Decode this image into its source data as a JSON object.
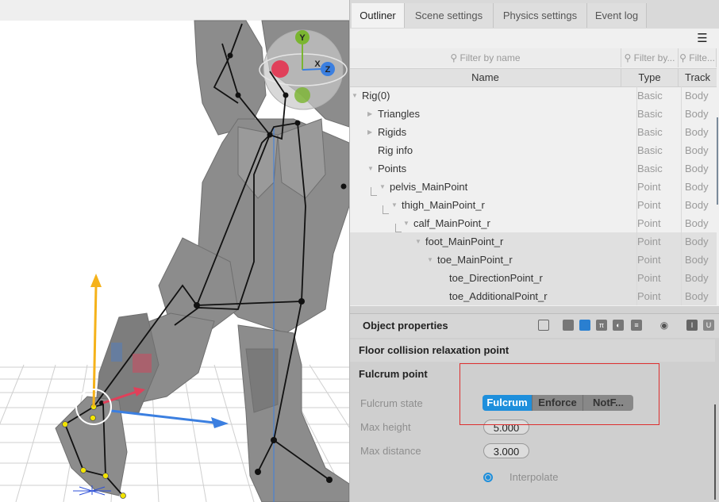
{
  "tabs": [
    "Outliner",
    "Scene settings",
    "Physics settings",
    "Event log"
  ],
  "outliner": {
    "menu_icon": "hamburger-menu-icon",
    "filters": {
      "name": "Filter by name",
      "type": "Filter by...",
      "track": "Filte..."
    },
    "columns": {
      "name": "Name",
      "type": "Type",
      "track": "Track"
    },
    "rows": [
      {
        "name": "Rig(0)",
        "type": "Basic",
        "track": "Body"
      },
      {
        "name": "Triangles",
        "type": "Basic",
        "track": "Body"
      },
      {
        "name": "Rigids",
        "type": "Basic",
        "track": "Body"
      },
      {
        "name": "Rig info",
        "type": "Basic",
        "track": "Body"
      },
      {
        "name": "Points",
        "type": "Basic",
        "track": "Body"
      },
      {
        "name": "pelvis_MainPoint",
        "type": "Point",
        "track": "Body"
      },
      {
        "name": "thigh_MainPoint_r",
        "type": "Point",
        "track": "Body"
      },
      {
        "name": "calf_MainPoint_r",
        "type": "Point",
        "track": "Body"
      },
      {
        "name": "foot_MainPoint_r",
        "type": "Point",
        "track": "Body"
      },
      {
        "name": "toe_MainPoint_r",
        "type": "Point",
        "track": "Body"
      },
      {
        "name": "toe_DirectionPoint_r",
        "type": "Point",
        "track": "Body"
      },
      {
        "name": "toe_AdditionalPoint_r",
        "type": "Point",
        "track": "Body"
      }
    ]
  },
  "properties": {
    "title": "Object properties",
    "section1": "Floor collision relaxation point",
    "section2": "Fulcrum point",
    "fulcrum_state_label": "Fulcrum state",
    "fulcrum_options": [
      "Fulcrum",
      "Enforce",
      "NotF..."
    ],
    "fulcrum_selected": "Fulcrum",
    "max_height_label": "Max height",
    "max_height": "5.000",
    "max_distance_label": "Max distance",
    "max_distance": "3.000",
    "interpolate_label": "Interpolate",
    "toolbar_icons": [
      "frame-icon",
      "grid-icon",
      "material-icon",
      "pi-icon",
      "mirror-icon",
      "list-icon",
      "eye-icon",
      "text-cursor-icon",
      "u-icon"
    ]
  },
  "gizmo": {
    "y": "Y",
    "x": "X",
    "z": "Z"
  },
  "colors": {
    "accent": "#1e8fdc",
    "highlight": "#dd2e2e",
    "gizmo_x": "#e0405a",
    "gizmo_y": "#7ab530",
    "gizmo_z": "#3b7fe0"
  }
}
